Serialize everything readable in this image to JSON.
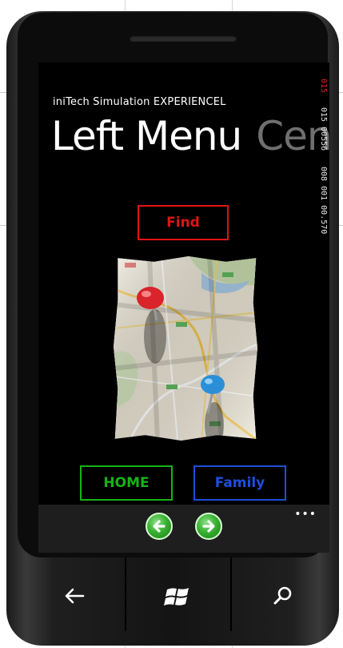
{
  "app": {
    "title": "iniTech Simulation EXPERIENCEL",
    "pivot_active": "Left Menu",
    "pivot_next": "Cen"
  },
  "frame_counter": {
    "line1": "015",
    "line2": "015 00556",
    "line3": "008 001 00.570"
  },
  "buttons": {
    "find": "Find",
    "home": "HOME",
    "family": "Family"
  },
  "app_bar": {
    "more": "•••",
    "back_icon": "arrow-left-icon",
    "forward_icon": "arrow-right-icon"
  },
  "hardware_keys": {
    "back": "back-arrow-icon",
    "start": "windows-logo-icon",
    "search": "search-icon"
  },
  "colors": {
    "find": "#e01414",
    "home": "#16b316",
    "family": "#1d4fdd",
    "pin_red": "#d8242a",
    "pin_blue": "#2b8fd8"
  }
}
